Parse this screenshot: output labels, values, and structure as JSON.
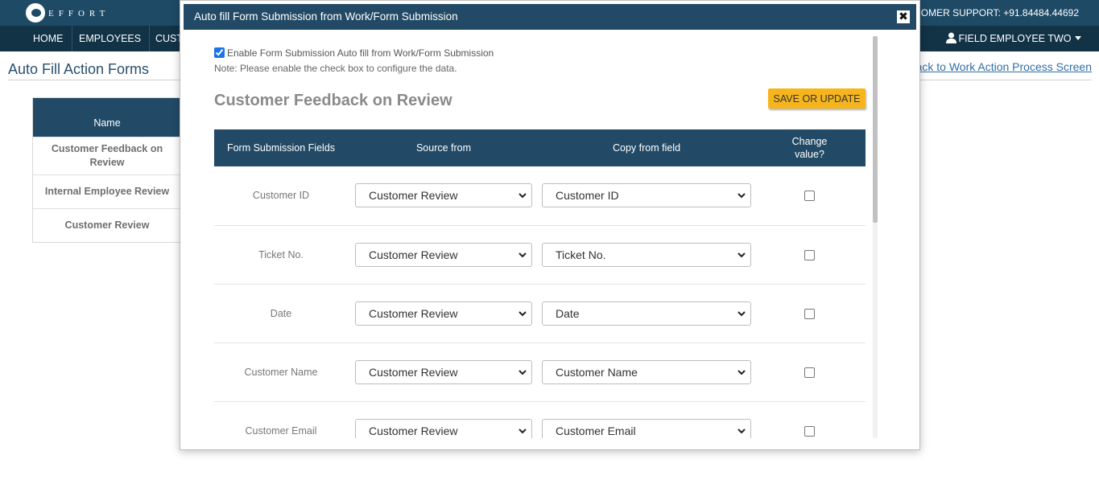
{
  "header": {
    "logo_text": "EFFORT",
    "support": "OMER SUPPORT: +91.84484.44692"
  },
  "nav": {
    "items": [
      "HOME",
      "EMPLOYEES",
      "CUST"
    ],
    "user": "FIELD EMPLOYEE TWO"
  },
  "page": {
    "title": "Auto Fill Action Forms",
    "back_link": "back to Work Action Process Screen",
    "table_header": "Name",
    "forms": [
      "Customer Feedback on Review",
      "Internal Employee Review",
      "Customer Review"
    ]
  },
  "modal": {
    "title": "Auto fill Form Submission from Work/Form Submission",
    "close_label": "✖",
    "enable_label": "Enable Form Submission Auto fill from Work/Form Submission",
    "enable_checked": true,
    "note": "Note: Please enable the check box to configure the data.",
    "form_title": "Customer Feedback on Review",
    "save_label": "SAVE OR UPDATE",
    "columns": [
      "Form Submission Fields",
      "Source from",
      "Copy from field",
      "Change value?"
    ],
    "rows": [
      {
        "field": "Customer ID",
        "source": "Customer Review",
        "copy": "Customer ID",
        "change": false
      },
      {
        "field": "Ticket No.",
        "source": "Customer Review",
        "copy": "Ticket No.",
        "change": false
      },
      {
        "field": "Date",
        "source": "Customer Review",
        "copy": "Date",
        "change": false
      },
      {
        "field": "Customer Name",
        "source": "Customer Review",
        "copy": "Customer Name",
        "change": false
      },
      {
        "field": "Customer Email",
        "source": "Customer Review",
        "copy": "Customer Email",
        "change": false
      }
    ]
  },
  "colors": {
    "header_dark": "#1e4a66",
    "nav_dark": "#123246",
    "accent_button": "#f6b51c",
    "link": "#2f6fa8"
  }
}
